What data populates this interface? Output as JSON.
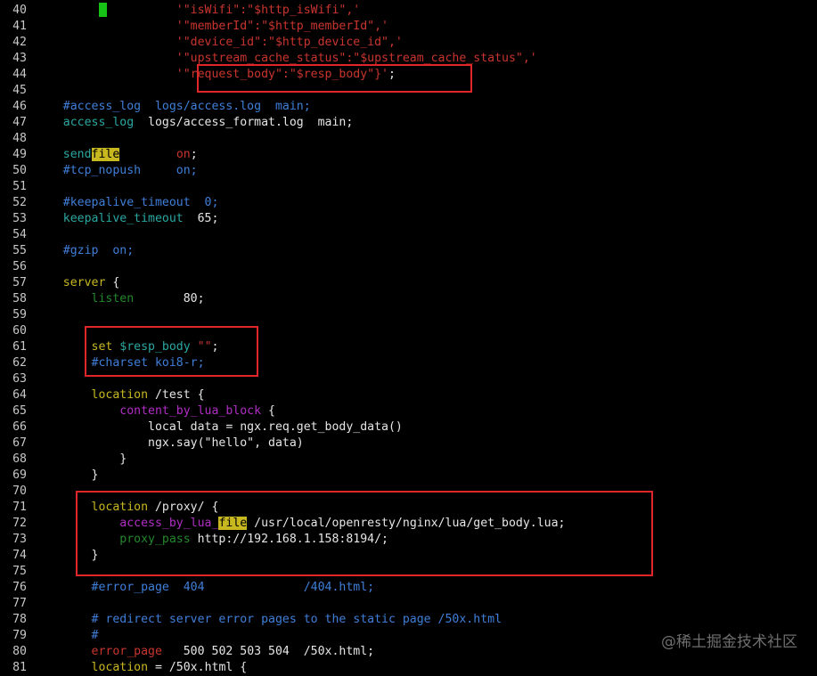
{
  "editor": {
    "lines": [
      {
        "num": "40",
        "tokens": [
          {
            "t": "                    '\"isWifi\":\"$http_isWifi\",'",
            "c": "t-string"
          }
        ]
      },
      {
        "num": "41",
        "tokens": [
          {
            "t": "                    '\"memberId\":\"$http_memberId\",'",
            "c": "t-string"
          }
        ]
      },
      {
        "num": "42",
        "tokens": [
          {
            "t": "                    '\"device_id\":\"$http_device_id\",'",
            "c": "t-string"
          }
        ]
      },
      {
        "num": "43",
        "tokens": [
          {
            "t": "                    '\"upstream_cache_status\":\"$upstream_cache_status\",'",
            "c": "t-string"
          }
        ]
      },
      {
        "num": "44",
        "tokens": [
          {
            "t": "                    '\"request_body\":\"$resp_body\"}'",
            "c": "t-string"
          },
          {
            "t": ";",
            "c": "t-default"
          }
        ]
      },
      {
        "num": "45",
        "tokens": []
      },
      {
        "num": "46",
        "tokens": [
          {
            "t": "    #access_log  logs/access.log  main;",
            "c": "t-comment"
          }
        ]
      },
      {
        "num": "47",
        "tokens": [
          {
            "t": "    access_log",
            "c": "t-teal"
          },
          {
            "t": "  logs/access_format.log  main;",
            "c": "t-default"
          }
        ]
      },
      {
        "num": "48",
        "tokens": []
      },
      {
        "num": "49",
        "tokens": [
          {
            "t": "    send",
            "c": "t-teal"
          },
          {
            "t": "file",
            "c": "t-hl"
          },
          {
            "t": "        ",
            "c": "t-default"
          },
          {
            "t": "on",
            "c": "t-string"
          },
          {
            "t": ";",
            "c": "t-default"
          }
        ]
      },
      {
        "num": "50",
        "tokens": [
          {
            "t": "    #tcp_nopush     on;",
            "c": "t-comment"
          }
        ]
      },
      {
        "num": "51",
        "tokens": []
      },
      {
        "num": "52",
        "tokens": [
          {
            "t": "    #keepalive_timeout  0;",
            "c": "t-comment"
          }
        ]
      },
      {
        "num": "53",
        "tokens": [
          {
            "t": "    keepalive_timeout",
            "c": "t-teal"
          },
          {
            "t": "  65;",
            "c": "t-default"
          }
        ]
      },
      {
        "num": "54",
        "tokens": []
      },
      {
        "num": "55",
        "tokens": [
          {
            "t": "    #gzip  on;",
            "c": "t-comment"
          }
        ]
      },
      {
        "num": "56",
        "tokens": []
      },
      {
        "num": "57",
        "tokens": [
          {
            "t": "    server",
            "c": "t-olive"
          },
          {
            "t": " {",
            "c": "t-default"
          }
        ]
      },
      {
        "num": "58",
        "tokens": [
          {
            "t": "        listen",
            "c": "t-green"
          },
          {
            "t": "       80;",
            "c": "t-default"
          }
        ]
      },
      {
        "num": "59",
        "tokens": []
      },
      {
        "num": "60",
        "tokens": []
      },
      {
        "num": "61",
        "tokens": [
          {
            "t": "        set",
            "c": "t-yellow"
          },
          {
            "t": " $resp_body ",
            "c": "t-teal"
          },
          {
            "t": "\"\"",
            "c": "t-string"
          },
          {
            "t": ";",
            "c": "t-default"
          }
        ]
      },
      {
        "num": "62",
        "tokens": [
          {
            "t": "        #charset koi8-r;",
            "c": "t-comment"
          }
        ]
      },
      {
        "num": "63",
        "tokens": []
      },
      {
        "num": "64",
        "tokens": [
          {
            "t": "        location",
            "c": "t-olive"
          },
          {
            "t": " /test {",
            "c": "t-default"
          }
        ]
      },
      {
        "num": "65",
        "tokens": [
          {
            "t": "            content_by_lua_block",
            "c": "t-magenta"
          },
          {
            "t": " {",
            "c": "t-default"
          }
        ]
      },
      {
        "num": "66",
        "tokens": [
          {
            "t": "                local data = ngx.req.get_body_data()",
            "c": "t-default"
          }
        ]
      },
      {
        "num": "67",
        "tokens": [
          {
            "t": "                ngx.say(\"hello\", data)",
            "c": "t-default"
          }
        ]
      },
      {
        "num": "68",
        "tokens": [
          {
            "t": "            }",
            "c": "t-default"
          }
        ]
      },
      {
        "num": "69",
        "tokens": [
          {
            "t": "        }",
            "c": "t-default"
          }
        ]
      },
      {
        "num": "70",
        "tokens": []
      },
      {
        "num": "71",
        "tokens": [
          {
            "t": "        location",
            "c": "t-olive"
          },
          {
            "t": " /proxy/ {",
            "c": "t-default"
          }
        ]
      },
      {
        "num": "72",
        "tokens": [
          {
            "t": "            access_by_lua_",
            "c": "t-magenta"
          },
          {
            "t": "file",
            "c": "t-hl"
          },
          {
            "t": " /usr/local/openresty/nginx/lua/get_body.lua;",
            "c": "t-default"
          }
        ]
      },
      {
        "num": "73",
        "tokens": [
          {
            "t": "            proxy_pass",
            "c": "t-green"
          },
          {
            "t": " http://192.168.1.158:8194/;",
            "c": "t-default"
          }
        ]
      },
      {
        "num": "74",
        "tokens": [
          {
            "t": "        }",
            "c": "t-default"
          }
        ]
      },
      {
        "num": "75",
        "tokens": []
      },
      {
        "num": "76",
        "tokens": [
          {
            "t": "        #error_page  404              /404.html;",
            "c": "t-comment"
          }
        ]
      },
      {
        "num": "77",
        "tokens": []
      },
      {
        "num": "78",
        "tokens": [
          {
            "t": "        # redirect server error pages to the static page /50x.html",
            "c": "t-comment"
          }
        ]
      },
      {
        "num": "79",
        "tokens": [
          {
            "t": "        #",
            "c": "t-comment"
          }
        ]
      },
      {
        "num": "80",
        "tokens": [
          {
            "t": "        error_page",
            "c": "t-string"
          },
          {
            "t": "   500 502 503 504  /50x.html;",
            "c": "t-default"
          }
        ]
      },
      {
        "num": "81",
        "tokens": [
          {
            "t": "        location",
            "c": "t-olive"
          },
          {
            "t": " = /50x.html {",
            "c": "t-default"
          }
        ]
      }
    ]
  },
  "watermark": "@稀土掘金技术社区",
  "colors": {
    "background": "#000000",
    "highlight_box": "#e0262a",
    "cursor": "#15c215",
    "search_highlight": "#c8b820"
  }
}
